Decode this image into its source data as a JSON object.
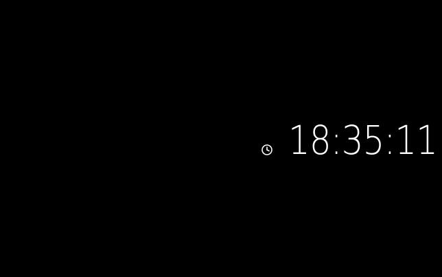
{
  "screen": {
    "background": "#000000",
    "accent": "#ffffff"
  },
  "clock": {
    "time": "18:35:11",
    "alarm_icon": "alarm-clock-icon"
  }
}
